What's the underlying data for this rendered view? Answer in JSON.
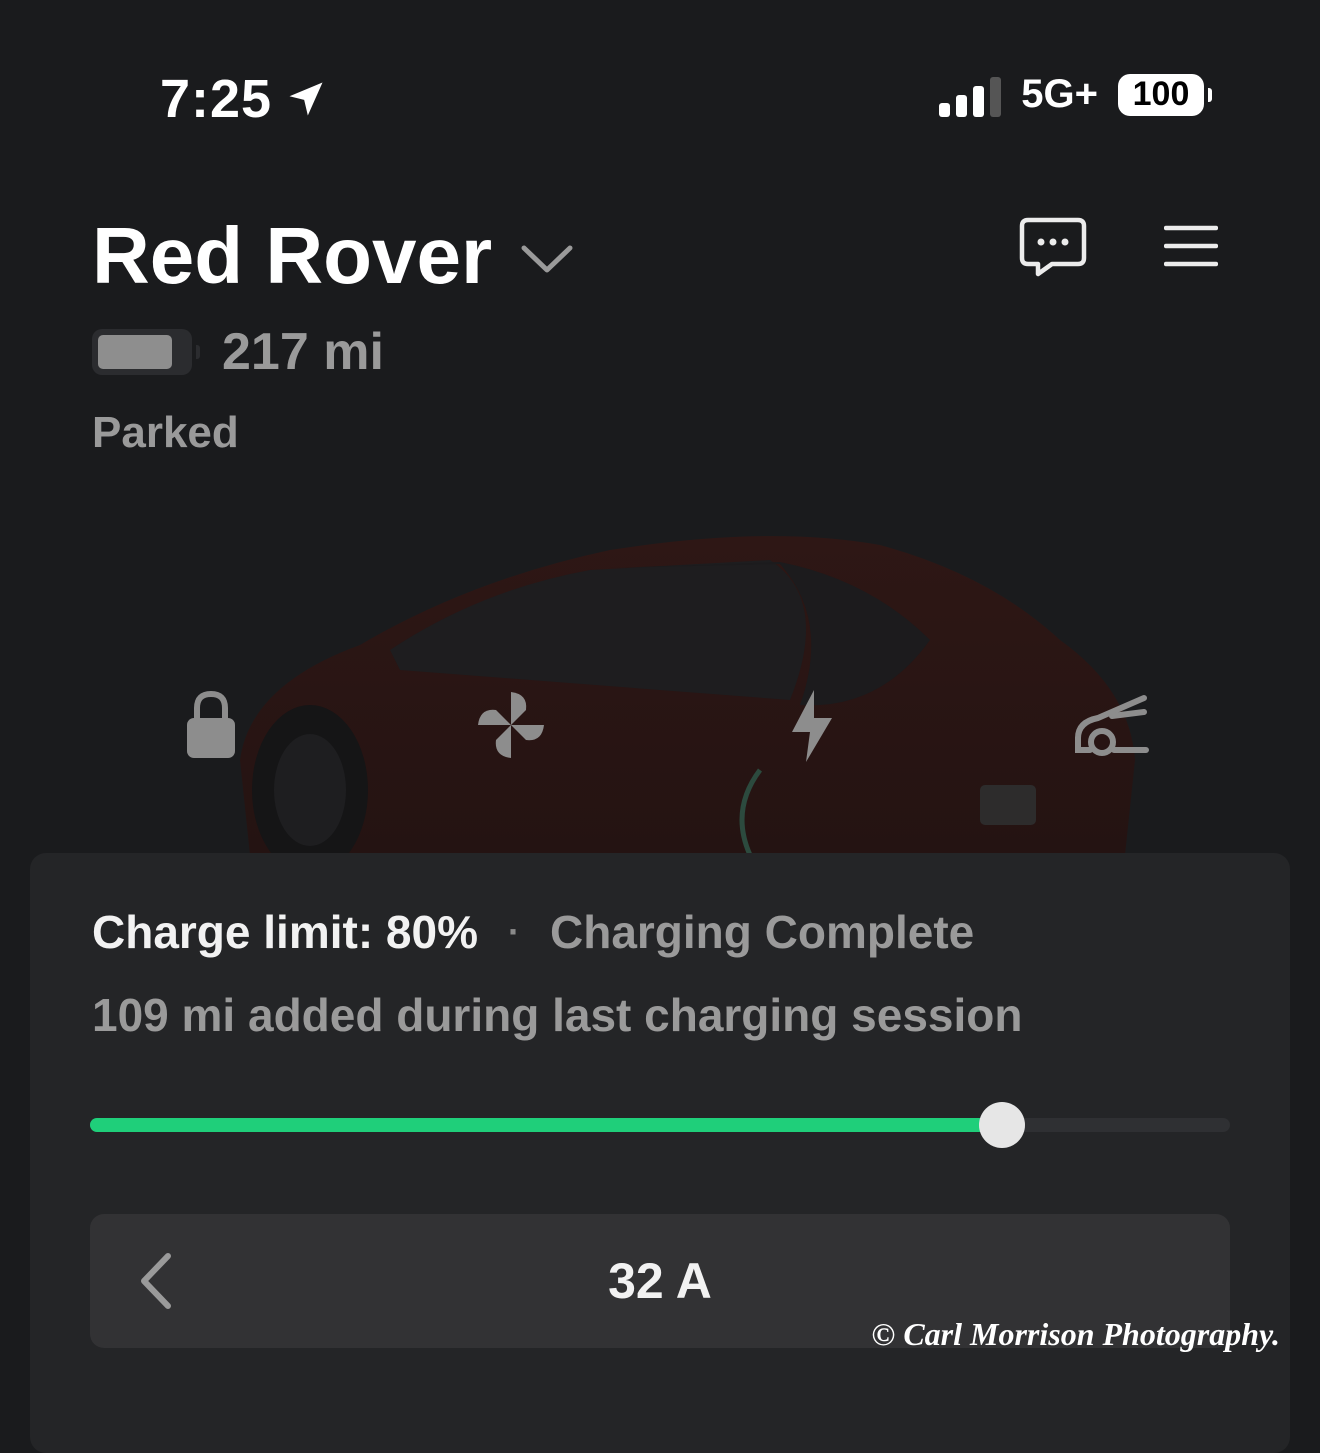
{
  "status_bar": {
    "time": "7:25",
    "network": "5G+",
    "battery": "100",
    "icons": [
      "location-arrow-icon",
      "cellular-signal-icon",
      "battery-icon"
    ]
  },
  "header": {
    "car_name": "Red Rover",
    "range": "217 mi",
    "status": "Parked",
    "icons": [
      "chevron-down-icon",
      "message-icon",
      "menu-icon"
    ]
  },
  "quick_controls": {
    "icons": [
      "lock-icon",
      "fan-icon",
      "charge-bolt-icon",
      "frunk-icon"
    ]
  },
  "charging": {
    "limit_label": "Charge limit: 80%",
    "separator": "·",
    "state": "Charging Complete",
    "added": "109 mi added during last charging session",
    "slider_level": 0.8,
    "amperage": "32 A",
    "accent_color": "#1fcf7a"
  },
  "watermark": "© Carl Morrison Photography."
}
